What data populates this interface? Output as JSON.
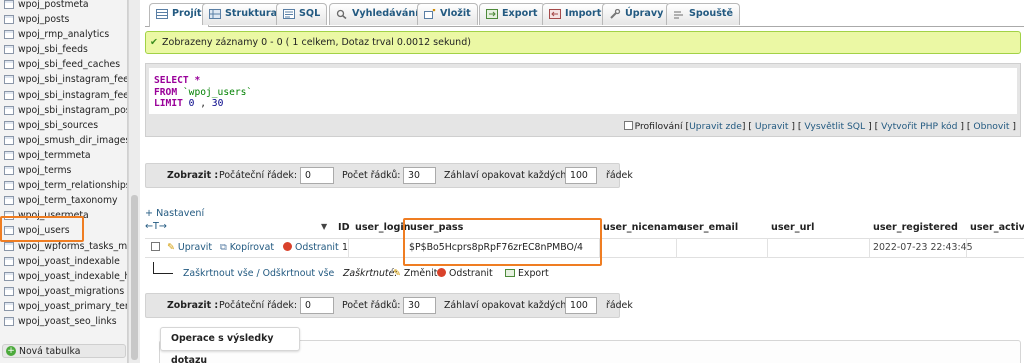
{
  "sidebar": {
    "tables": [
      "wpoj_postmeta",
      "wpoj_posts",
      "wpoj_rmp_analytics",
      "wpoj_sbi_feeds",
      "wpoj_sbi_feed_caches",
      "wpoj_sbi_instagram_feeds",
      "wpoj_sbi_instagram_feed_",
      "wpoj_sbi_instagram_posts",
      "wpoj_sbi_sources",
      "wpoj_smush_dir_images",
      "wpoj_termmeta",
      "wpoj_terms",
      "wpoj_term_relationships",
      "wpoj_term_taxonomy",
      "wpoj_usermeta",
      "wpoj_users",
      "wpoj_wpforms_tasks_met",
      "wpoj_yoast_indexable",
      "wpoj_yoast_indexable_hie",
      "wpoj_yoast_migrations",
      "wpoj_yoast_primary_term",
      "wpoj_yoast_seo_links"
    ],
    "selected_table": "wpoj_users",
    "new_table_label": "Nová tabulka"
  },
  "tabs": [
    {
      "label": "Projít",
      "icon": "browse-icon",
      "active": true
    },
    {
      "label": "Struktura",
      "icon": "structure-icon"
    },
    {
      "label": "SQL",
      "icon": "sql-icon"
    },
    {
      "label": "Vyhledávání",
      "icon": "search-icon"
    },
    {
      "label": "Vložit",
      "icon": "insert-icon"
    },
    {
      "label": "Export",
      "icon": "export-icon"
    },
    {
      "label": "Import",
      "icon": "import-icon"
    },
    {
      "label": "Úpravy",
      "icon": "wrench-icon"
    },
    {
      "label": "Spouště",
      "icon": "triggers-icon"
    }
  ],
  "success_message": "Zobrazeny záznamy 0 - 0 ( 1 celkem, Dotaz trval 0.0012 sekund)",
  "sql": {
    "select": "SELECT",
    "star": "*",
    "from": "FROM",
    "table": "`wpoj_users`",
    "limit": "LIMIT",
    "offset": "0",
    "comma": ",",
    "count": "30"
  },
  "sql_actions": {
    "profiling": "Profilování",
    "edit_inline": "Upravit zde",
    "edit": "Upravit",
    "explain": "Vysvětlit SQL",
    "create_php": "Vytvořit PHP kód",
    "refresh": "Obnovit"
  },
  "nav": {
    "show_label": "Zobrazit :",
    "start_row_label": "Počáteční řádek:",
    "start_row_value": "0",
    "row_count_label": "Počet řádků:",
    "row_count_value": "30",
    "repeat_header_label": "Záhlaví opakovat každých",
    "repeat_header_value": "100",
    "rows_label": "řádek"
  },
  "settings_link": "+ Nastavení",
  "results": {
    "columns": [
      "ID",
      "user_login",
      "user_pass",
      "user_nicename",
      "user_email",
      "user_url",
      "user_registered",
      "user_activat"
    ],
    "row_actions": {
      "edit": "Upravit",
      "copy": "Kopírovat",
      "delete": "Odstranit"
    },
    "row": {
      "ID": "1",
      "user_login": "",
      "user_pass": "$P$Bo5Hcprs8pRpF76zrEC8nPMBO/4",
      "user_nicename": "",
      "user_email": "",
      "user_url": "",
      "user_registered": "2022-07-23 22:43:45",
      "user_activat": ""
    }
  },
  "bulk": {
    "check_all": "Zaškrtnout vše / Odškrtnout vše",
    "checked_label": "Zaškrtnuté:",
    "edit": "Změnit",
    "delete": "Odstranit",
    "export": "Export"
  },
  "query_ops_title": "Operace s výsledky dotazu",
  "colors": {
    "highlight": "#ef7d22",
    "link": "#235a81",
    "success_bg": "#ebf8a4",
    "sql_keyword": "#990099"
  }
}
